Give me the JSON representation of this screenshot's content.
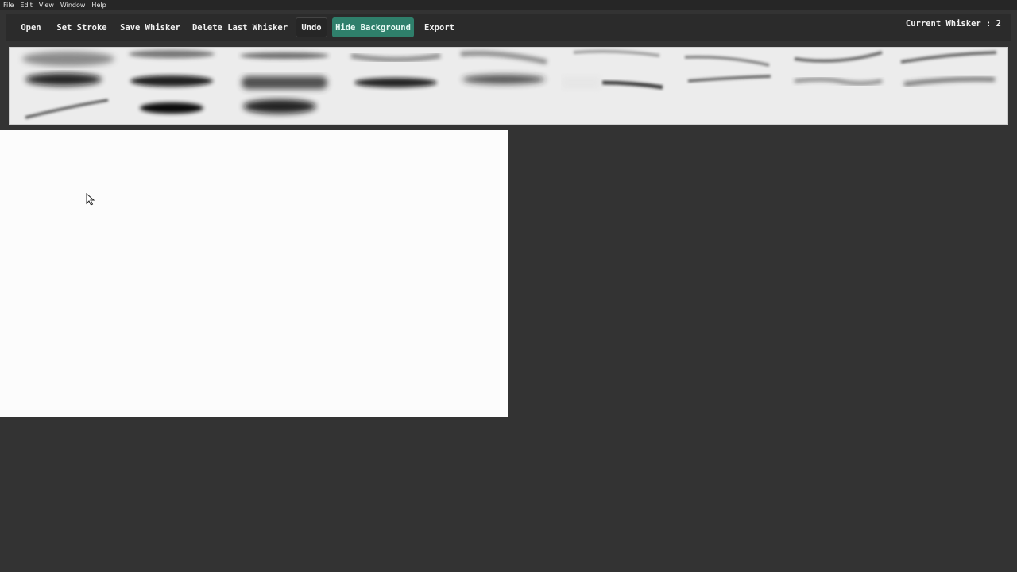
{
  "menubar": {
    "items": [
      {
        "label": "File"
      },
      {
        "label": "Edit"
      },
      {
        "label": "View"
      },
      {
        "label": "Window"
      },
      {
        "label": "Help"
      }
    ]
  },
  "toolbar": {
    "open_label": "Open",
    "set_stroke_label": "Set Stroke",
    "save_whisker_label": "Save Whisker",
    "delete_last_label": "Delete Last Whisker",
    "undo_label": "Undo",
    "hide_background_label": "Hide Background",
    "export_label": "Export",
    "status_text": "Current Whisker : 2"
  },
  "colors": {
    "app_background": "#333333",
    "accent": "#2f7f6b",
    "canvas": "#fcfcfc",
    "strip_background": "#ececec"
  },
  "icons": {
    "cursor": "arrow-pointer-icon"
  },
  "whisker_library": {
    "count": 21
  }
}
